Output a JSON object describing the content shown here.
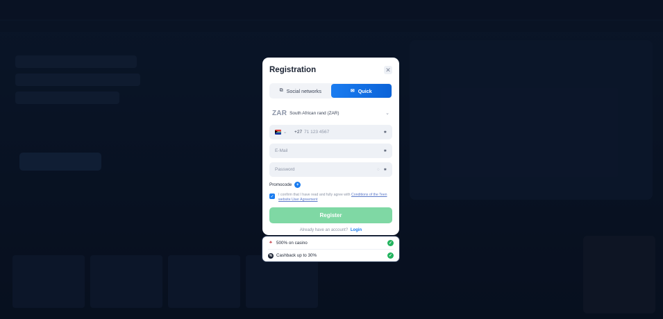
{
  "modal": {
    "title": "Registration",
    "close_icon": "close-icon",
    "tabs": [
      {
        "label": "Social networks",
        "icon": "share-icon",
        "active": false
      },
      {
        "label": "Quick",
        "icon": "envelope-icon",
        "active": true
      }
    ],
    "currency": {
      "code": "ZAR",
      "name": "South African rand (ZAR)"
    },
    "phone": {
      "prefix": "+27",
      "placeholder": "71 123 4567",
      "country_flag": "south-africa-flag"
    },
    "email": {
      "placeholder": "E-Mail"
    },
    "password": {
      "placeholder": "Password"
    },
    "promocode_label": "Promocode",
    "promocode_toggle": "+",
    "confirm": {
      "checked": true,
      "text": "I confirm that I have read and fully agree with ",
      "link": "Conditions of the Teen website User Agreement"
    },
    "register_label": "Register",
    "login_prompt": "Already have an account?",
    "login_link": "Login"
  },
  "bonuses": [
    {
      "label": "500% on casino",
      "icon": "casino-chip-icon"
    },
    {
      "label": "Cashback up to 30%",
      "icon": "cashback-icon"
    }
  ],
  "colors": {
    "accent": "#1a7cf0",
    "register_button": "#7fd8a4",
    "check_green": "#22b35e",
    "background": "#0c1529"
  }
}
